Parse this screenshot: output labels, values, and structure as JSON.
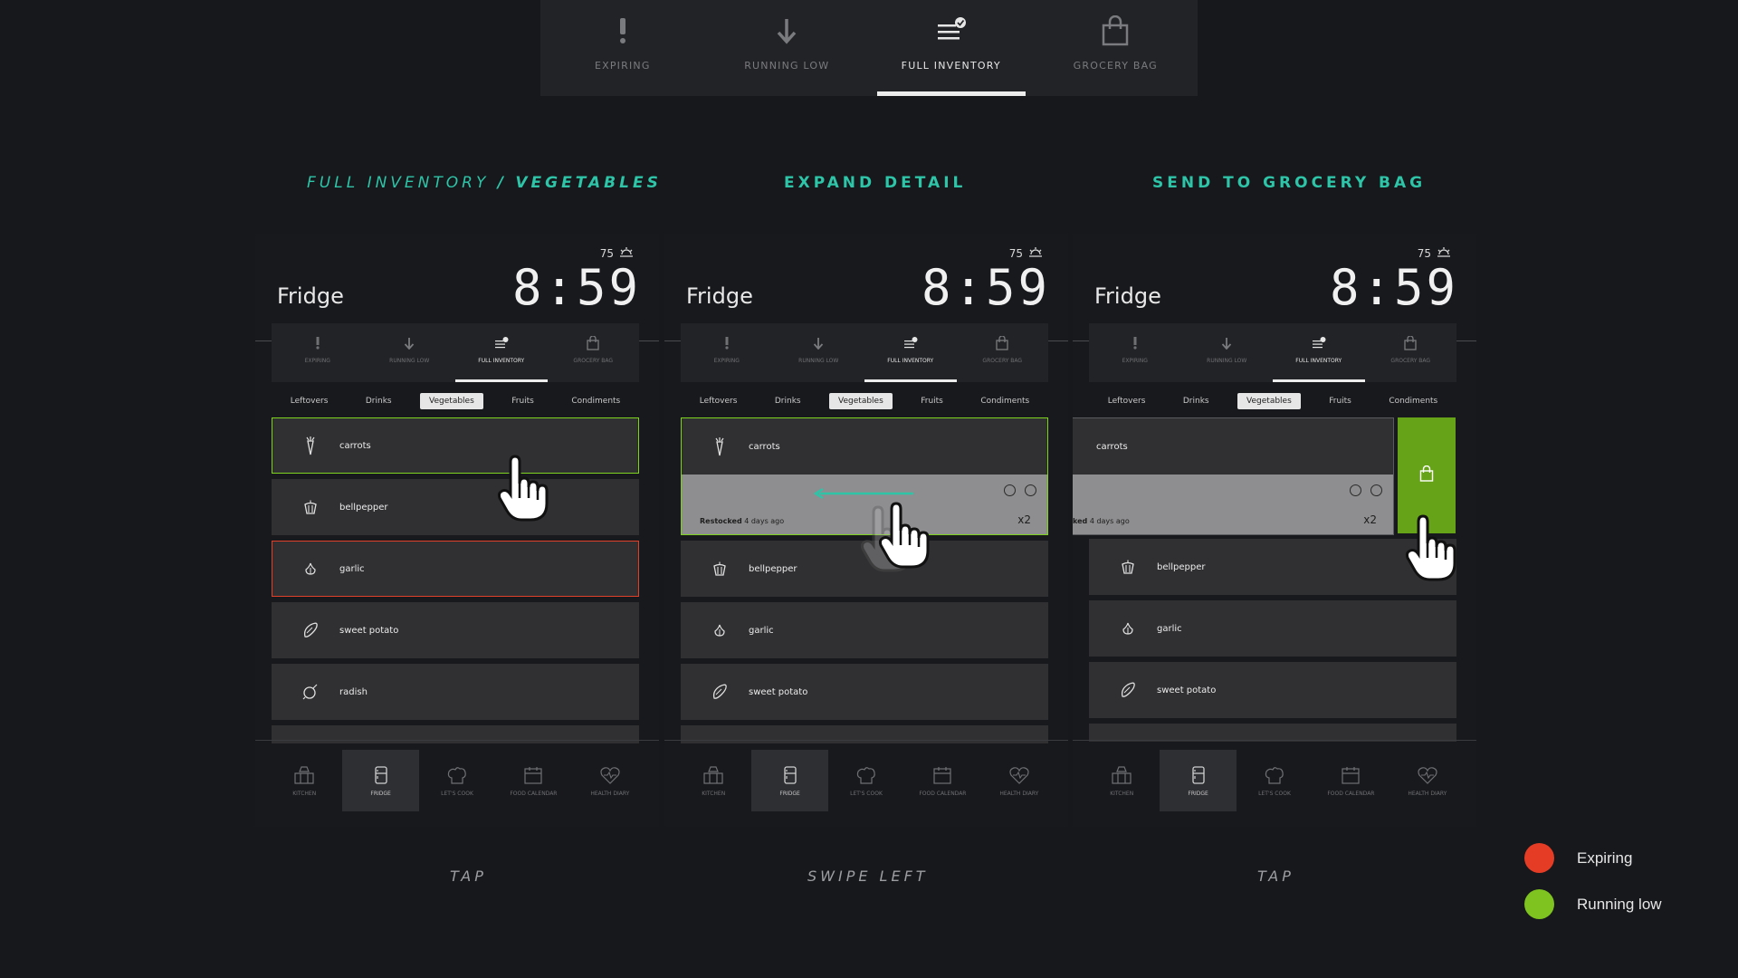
{
  "top_tabs": [
    {
      "label": "EXPIRING",
      "icon": "exclamation-icon",
      "active": false
    },
    {
      "label": "RUNNING LOW",
      "icon": "arrow-down-icon",
      "active": false
    },
    {
      "label": "FULL INVENTORY",
      "icon": "list-check-icon",
      "active": true
    },
    {
      "label": "GROCERY BAG",
      "icon": "shopping-bag-icon",
      "active": false
    }
  ],
  "headings": {
    "full_inventory": "FULL INVENTORY",
    "slash": "/",
    "vegetables": "VEGETABLES",
    "expand_detail": "EXPAND DETAIL",
    "send_to_grocery_bag": "SEND TO GROCERY BAG"
  },
  "screen": {
    "temperature": "75",
    "weather_icon": "sunrise-icon",
    "title": "Fridge",
    "time": "8:59",
    "tabs": [
      "EXPIRING",
      "RUNNING LOW",
      "FULL INVENTORY",
      "GROCERY BAG"
    ],
    "categories": [
      "Leftovers",
      "Drinks",
      "Vegetables",
      "Fruits",
      "Condiments"
    ],
    "selected_category": "Vegetables",
    "bottom_nav": [
      "KITCHEN",
      "FRIDGE",
      "LET'S COOK",
      "FOOD CALENDAR",
      "HEALTH DIARY"
    ],
    "active_nav": "FRIDGE"
  },
  "items": [
    {
      "name": "carrots",
      "icon": "carrot-icon",
      "status": "running-low"
    },
    {
      "name": "bellpepper",
      "icon": "bellpepper-icon",
      "status": "normal"
    },
    {
      "name": "garlic",
      "icon": "garlic-icon",
      "status": "expiring"
    },
    {
      "name": "sweet potato",
      "icon": "sweet-potato-icon",
      "status": "normal"
    },
    {
      "name": "radish",
      "icon": "radish-icon",
      "status": "normal"
    }
  ],
  "detail": {
    "restocked_label": "Restocked",
    "restocked_partial": "ked",
    "restocked_time": "4 days ago",
    "quantity": "x2"
  },
  "gestures": [
    "TAP",
    "SWIPE LEFT",
    "TAP"
  ],
  "legend": [
    {
      "label": "Expiring",
      "color": "#e53d25"
    },
    {
      "label": "Running low",
      "color": "#7ec31f"
    }
  ]
}
